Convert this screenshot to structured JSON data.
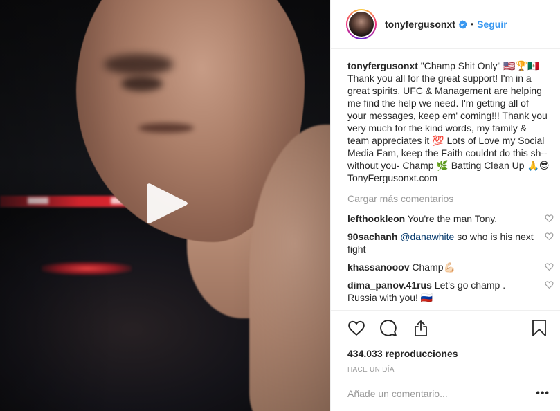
{
  "post": {
    "username": "tonyfergusonxt",
    "follow_label": "Seguir",
    "dot": "•"
  },
  "caption": {
    "username": "tonyfergusonxt",
    "text": " \"Champ Shit Only\" 🇺🇸🏆🇲🇽 Thank you all for the great support! I'm in a great spirits, UFC & Management are helping me find the help we need. I'm getting all of your messages, keep em' coming!!! Thank you very much for the kind words, my family & team appreciates it 💯 Lots of Love my Social Media Fam, keep the Faith couldnt do this sh-- without you- Champ 🌿 Batting Clean Up 🙏😎 TonyFergusonxt.com"
  },
  "load_more": "Cargar más comentarios",
  "comments": [
    {
      "user": "lefthookleon",
      "pre": "",
      "mention": "",
      "text": " You're the man Tony."
    },
    {
      "user": "90sachanh",
      "pre": " ",
      "mention": "@danawhite",
      "text": " so who is his next fight"
    },
    {
      "user": "khassanooov",
      "pre": "",
      "mention": "",
      "text": " Champ💪🏻"
    },
    {
      "user": "dima_panov.41rus",
      "pre": "",
      "mention": "",
      "text": " Let's go champ . Russia with you! 🇷🇺"
    }
  ],
  "stats": {
    "views": "434.033 reproducciones",
    "time": "Hace un día"
  },
  "add_comment": {
    "placeholder": "Añade un comentario...",
    "more": "•••"
  },
  "colors": {
    "accent": "#3897f0",
    "verified": "#3897f0",
    "muted": "#999999",
    "text": "#262626"
  },
  "icons": [
    "play-icon",
    "verified-icon",
    "heart-icon",
    "comment-icon",
    "share-icon",
    "bookmark-icon",
    "more-icon"
  ]
}
